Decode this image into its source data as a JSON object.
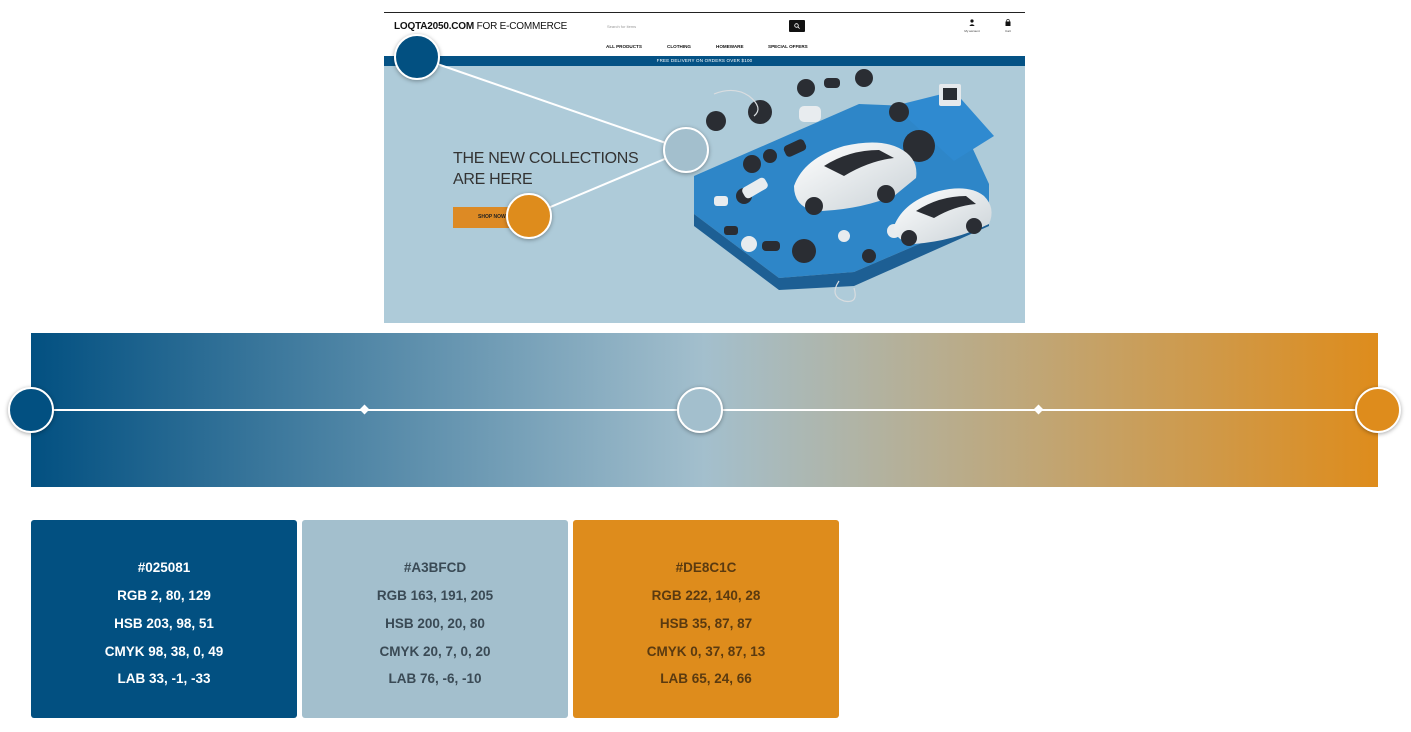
{
  "screenshot": {
    "brand": {
      "strong": "LOQTA2050.COM",
      "rest": " FOR E-COMMERCE"
    },
    "search_placeholder": "Search for items",
    "account_label": "My account",
    "cart_label": "Cart",
    "nav": [
      "ALL PRODUCTS",
      "CLOTHING",
      "HOMEWARE",
      "SPECIAL OFFERS"
    ],
    "promo": "FREE DELIVERY ON ORDERS OVER $100",
    "hero_title_line1": "THE NEW COLLECTIONS",
    "hero_title_line2": "ARE HERE",
    "shop_button": "SHOP NOW"
  },
  "gradient": {
    "start": "#025081",
    "mid": "#A3BFCD",
    "end": "#DE8C1C"
  },
  "swatches": [
    {
      "hex": "#025081",
      "rgb": "RGB 2, 80, 129",
      "hsb": "HSB 203, 98, 51",
      "cmyk": "CMYK 98, 38, 0, 49",
      "lab": "LAB 33, -1, -33",
      "bg": "#025081",
      "text_color": "#ffffff"
    },
    {
      "hex": "#A3BFCD",
      "rgb": "RGB 163, 191, 205",
      "hsb": "HSB 200, 20, 80",
      "cmyk": "CMYK 20, 7, 0, 20",
      "lab": "LAB 76, -6, -10",
      "bg": "#A3BFCD",
      "text_color": "#3a4a55"
    },
    {
      "hex": "#DE8C1C",
      "rgb": "RGB 222, 140, 28",
      "hsb": "HSB 35, 87, 87",
      "cmyk": "CMYK 0, 37, 87, 13",
      "lab": "LAB 65, 24, 66",
      "bg": "#DE8C1C",
      "text_color": "#5a3a10"
    }
  ]
}
